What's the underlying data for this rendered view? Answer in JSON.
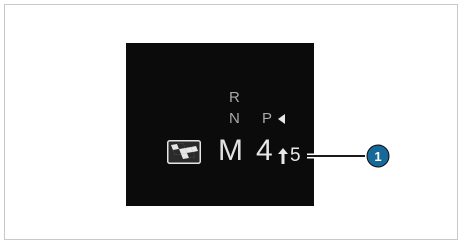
{
  "display": {
    "gears": {
      "reverse": "R",
      "neutral": "N",
      "park": "P",
      "current_mode": "M",
      "current_gear": "4",
      "next_gear": "5"
    },
    "icons": {
      "drive_program": "checkered-flag-icon",
      "park_indicator": "triangle-left-icon",
      "upshift": "up-arrow-icon"
    },
    "callout": {
      "number": "1"
    }
  },
  "colors": {
    "display_background": "#0b0b0b",
    "inactive_gear": "#a9a9a9",
    "active_gear": "#e8e8e8",
    "callout_fill": "#17699a",
    "frame_border": "#c9c9c9"
  }
}
